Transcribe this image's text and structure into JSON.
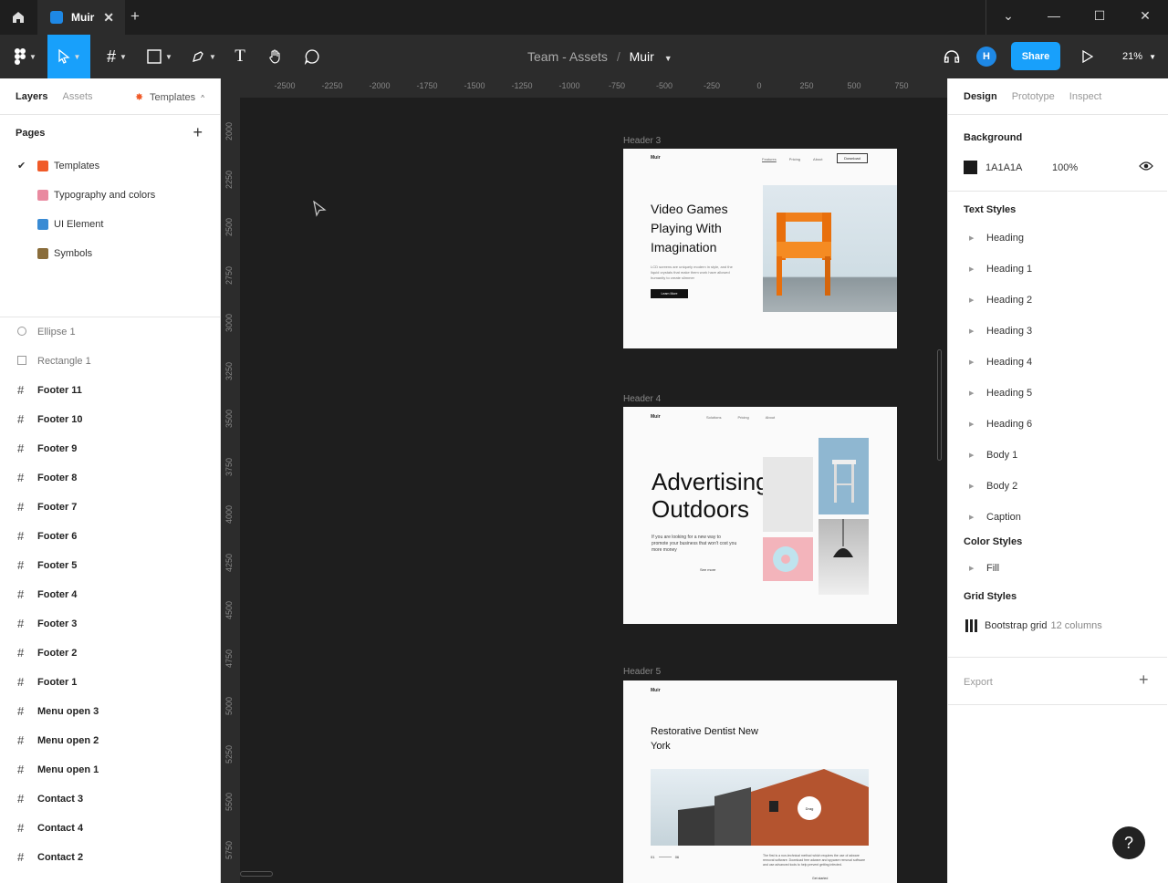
{
  "titlebar": {
    "tab_title": "Muir"
  },
  "toolbar": {
    "breadcrumb_team": "Team - Assets",
    "breadcrumb_sep": "/",
    "breadcrumb_file": "Muir",
    "share_label": "Share",
    "avatar_initial": "H",
    "zoom_label": "21%"
  },
  "left_panel": {
    "tabs": {
      "layers": "Layers",
      "assets": "Assets",
      "templates": "Templates"
    },
    "pages_title": "Pages",
    "pages": [
      {
        "label": "Templates",
        "color": "#f05a28"
      },
      {
        "label": "Typography and colors",
        "color": "#e98aa0"
      },
      {
        "label": "UI Element",
        "color": "#3a8bd4"
      },
      {
        "label": "Symbols",
        "color": "#8a6d3b"
      }
    ],
    "layers": [
      {
        "label": "Ellipse 1",
        "icon": "ellipse-icon"
      },
      {
        "label": "Rectangle 1",
        "icon": "rectangle-icon"
      },
      {
        "label": "Footer 11",
        "icon": "frame-icon"
      },
      {
        "label": "Footer 10",
        "icon": "frame-icon"
      },
      {
        "label": "Footer 9",
        "icon": "frame-icon"
      },
      {
        "label": "Footer 8",
        "icon": "frame-icon"
      },
      {
        "label": "Footer 7",
        "icon": "frame-icon"
      },
      {
        "label": "Footer 6",
        "icon": "frame-icon"
      },
      {
        "label": "Footer 5",
        "icon": "frame-icon"
      },
      {
        "label": "Footer 4",
        "icon": "frame-icon"
      },
      {
        "label": "Footer 3",
        "icon": "frame-icon"
      },
      {
        "label": "Footer 2",
        "icon": "frame-icon"
      },
      {
        "label": "Footer 1",
        "icon": "frame-icon"
      },
      {
        "label": "Menu open 3",
        "icon": "frame-icon"
      },
      {
        "label": "Menu open 2",
        "icon": "frame-icon"
      },
      {
        "label": "Menu open 1",
        "icon": "frame-icon"
      },
      {
        "label": "Contact 3",
        "icon": "frame-icon"
      },
      {
        "label": "Contact 4",
        "icon": "frame-icon"
      },
      {
        "label": "Contact 2",
        "icon": "frame-icon"
      }
    ]
  },
  "canvas": {
    "ruler_x": [
      "-2500",
      "-2250",
      "-2000",
      "-1750",
      "-1500",
      "-1250",
      "-1000",
      "-750",
      "-500",
      "-250",
      "0",
      "250",
      "500",
      "750"
    ],
    "ruler_y": [
      "2000",
      "2250",
      "2500",
      "2750",
      "3000",
      "3250",
      "3500",
      "3750",
      "4000",
      "4250",
      "4500",
      "4750",
      "5000",
      "5250",
      "5500",
      "5750"
    ],
    "frames": {
      "header3": {
        "label": "Header 3",
        "logo": "Muir",
        "nav": [
          "Features",
          "Pricing",
          "About"
        ],
        "cta": "Download",
        "heading": "Video Games Playing With Imagination",
        "body": "LCD screens are uniquely modern in style, and the liquid crystals that make them work have allowed humanity to create slimmer",
        "button": "Learn More"
      },
      "header4": {
        "label": "Header 4",
        "logo": "Muir",
        "nav": [
          "Solutions",
          "Pricing",
          "About"
        ],
        "heading": "Advertising Outdoors",
        "body": "If you are looking for a new way to promote your business that won't cost you more money",
        "link": "See more"
      },
      "header5": {
        "label": "Header 5",
        "logo": "Muir",
        "heading": "Restorative Dentist New York",
        "drag": "Drag",
        "counter_a": "01",
        "counter_b": "06",
        "body": "The first is a non-technical method which requires the use of adware removal software. Download free adware and spyware removal software and use advanced tools to help prevent getting infected.",
        "link": "Get started"
      }
    }
  },
  "right_panel": {
    "tabs": {
      "design": "Design",
      "prototype": "Prototype",
      "inspect": "Inspect"
    },
    "background_title": "Background",
    "background_hex": "1A1A1A",
    "background_opacity": "100%",
    "background_color": "#1A1A1A",
    "text_styles_title": "Text Styles",
    "text_styles": [
      "Heading",
      "Heading 1",
      "Heading 2",
      "Heading 3",
      "Heading 4",
      "Heading 5",
      "Heading 6",
      "Body 1",
      "Body 2",
      "Caption"
    ],
    "color_styles_title": "Color Styles",
    "color_styles": [
      "Fill"
    ],
    "grid_styles_title": "Grid Styles",
    "grid_style_name": "Bootstrap grid",
    "grid_style_detail": "12 columns",
    "export_title": "Export"
  },
  "help_label": "?"
}
